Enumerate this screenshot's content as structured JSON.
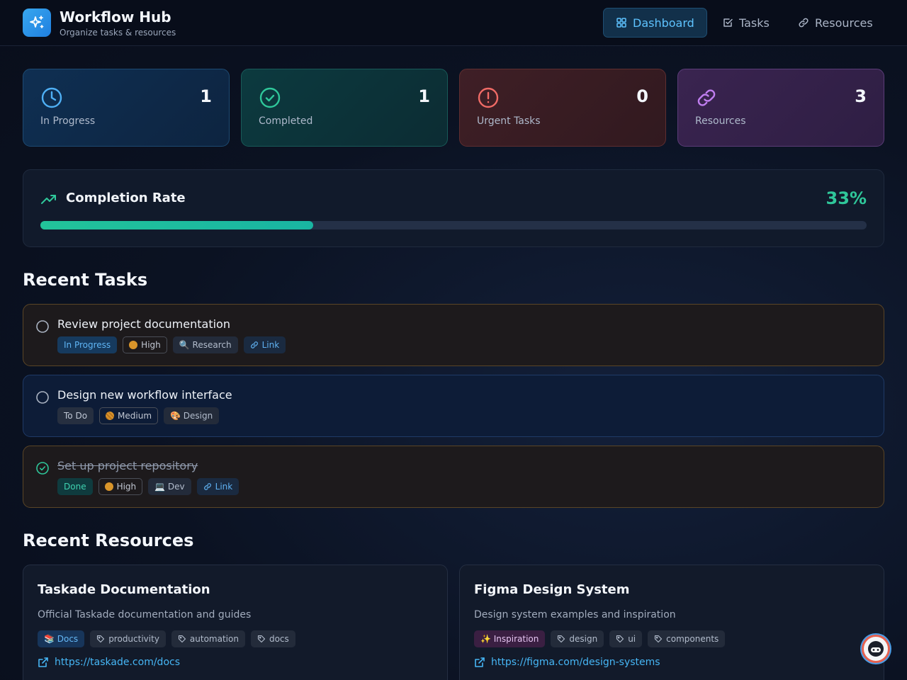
{
  "header": {
    "title": "Workflow Hub",
    "subtitle": "Organize tasks & resources",
    "nav": [
      {
        "label": "Dashboard",
        "icon": "grid-icon",
        "active": true
      },
      {
        "label": "Tasks",
        "icon": "checkbox-icon",
        "active": false
      },
      {
        "label": "Resources",
        "icon": "link-icon",
        "active": false
      }
    ]
  },
  "stats": [
    {
      "value": "1",
      "label": "In Progress",
      "icon": "clock-icon",
      "color": "#4fb0f5"
    },
    {
      "value": "1",
      "label": "Completed",
      "icon": "check-circle-icon",
      "color": "#2fc79a"
    },
    {
      "value": "0",
      "label": "Urgent Tasks",
      "icon": "alert-circle-icon",
      "color": "#f06b66"
    },
    {
      "value": "3",
      "label": "Resources",
      "icon": "link-icon",
      "color": "#c07ef0"
    }
  ],
  "completion": {
    "title": "Completion Rate",
    "percent_label": "33%",
    "fraction": 0.33
  },
  "recent_tasks": {
    "heading": "Recent Tasks",
    "items": [
      {
        "title": "Review project documentation",
        "done": false,
        "status": "In Progress",
        "priority": "High",
        "category": "🔍 Research",
        "link": "Link"
      },
      {
        "title": "Design new workflow interface",
        "done": false,
        "status": "To Do",
        "priority": "Medium",
        "category": "🎨 Design",
        "link": ""
      },
      {
        "title": "Set up project repository",
        "done": true,
        "status": "Done",
        "priority": "High",
        "category": "💻 Dev",
        "link": "Link"
      }
    ]
  },
  "recent_resources": {
    "heading": "Recent Resources",
    "items": [
      {
        "title": "Taskade Documentation",
        "description": "Official Taskade documentation and guides",
        "category": "📚 Docs",
        "tags": [
          "productivity",
          "automation",
          "docs"
        ],
        "url": "https://taskade.com/docs"
      },
      {
        "title": "Figma Design System",
        "description": "Design system examples and inspiration",
        "category": "✨ Inspiration",
        "tags": [
          "design",
          "ui",
          "components"
        ],
        "url": "https://figma.com/design-systems"
      }
    ]
  },
  "colors": {
    "accent": "#5ec3ff",
    "success": "#2fc79a",
    "brand": "#2b93ea"
  }
}
